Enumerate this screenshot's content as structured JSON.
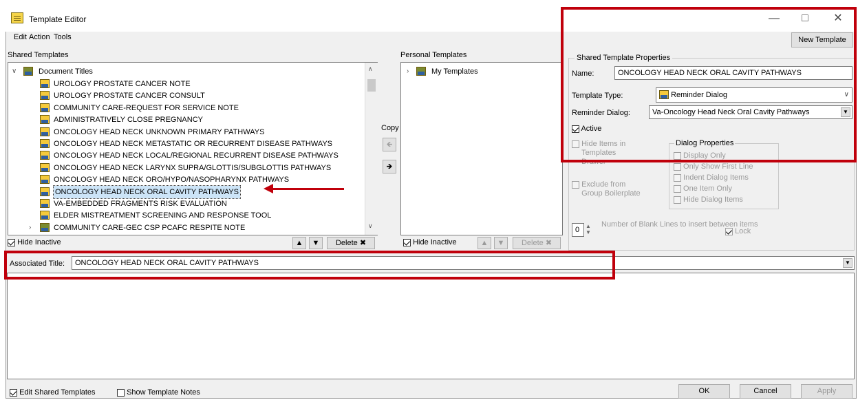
{
  "window": {
    "title": "Template Editor"
  },
  "menu": {
    "edit": "Edit",
    "action": "Action",
    "tools": "Tools"
  },
  "toolbar": {
    "new_template": "New Template"
  },
  "shared": {
    "label": "Shared Templates",
    "root": "Document Titles",
    "items": [
      "UROLOGY PROSTATE CANCER NOTE",
      "UROLOGY PROSTATE CANCER CONSULT",
      "COMMUNITY CARE-REQUEST FOR SERVICE NOTE",
      "ADMINISTRATIVELY CLOSE PREGNANCY",
      "ONCOLOGY HEAD NECK UNKNOWN PRIMARY PATHWAYS",
      "ONCOLOGY HEAD NECK METASTATIC OR RECURRENT DISEASE PATHWAYS",
      "ONCOLOGY HEAD NECK LOCAL/REGIONAL RECURRENT DISEASE PATHWAYS",
      "ONCOLOGY HEAD NECK LARYNX SUPRA/GLOTTIS/SUBGLOTTIS PATHWAYS",
      "ONCOLOGY HEAD NECK ORO/HYPO/NASOPHARYNX PATHWAYS",
      "ONCOLOGY HEAD NECK ORAL CAVITY PATHWAYS",
      "VA-EMBEDDED FRAGMENTS RISK EVALUATION",
      "ELDER MISTREATMENT SCREENING AND RESPONSE TOOL",
      "COMMUNITY CARE-GEC CSP PCAFC RESPITE NOTE"
    ],
    "selected_index": 9,
    "hide_inactive": "Hide Inactive",
    "delete": "Delete"
  },
  "copy_label": "Copy",
  "personal": {
    "label": "Personal Templates",
    "root": "My Templates",
    "hide_inactive": "Hide Inactive",
    "delete": "Delete"
  },
  "props": {
    "group_label": "Shared Template Properties",
    "name_label": "Name:",
    "name_value": "ONCOLOGY HEAD NECK ORAL CAVITY PATHWAYS",
    "type_label": "Template Type:",
    "type_value": "Reminder Dialog",
    "reminder_label": "Reminder Dialog:",
    "reminder_value": "Va-Oncology Head Neck Oral Cavity Pathways",
    "active": "Active",
    "hide_items": "Hide Items in Templates Drawer",
    "exclude": "Exclude from Group Boilerplate",
    "dialog_props_label": "Dialog Properties",
    "dialog_props": [
      "Display Only",
      "Only Show First Line",
      "Indent Dialog Items",
      "One Item Only",
      "Hide Dialog Items"
    ],
    "blank_lines_value": "0",
    "blank_lines_label": "Number of Blank Lines to insert between items",
    "lock": "Lock"
  },
  "associated": {
    "label": "Associated Title:",
    "value": "ONCOLOGY HEAD NECK ORAL CAVITY PATHWAYS"
  },
  "footer": {
    "edit_shared": "Edit Shared Templates",
    "show_notes": "Show Template Notes",
    "ok": "OK",
    "cancel": "Cancel",
    "apply": "Apply"
  },
  "colors": {
    "highlight": "#c0000b",
    "selection": "#cce4f7"
  }
}
